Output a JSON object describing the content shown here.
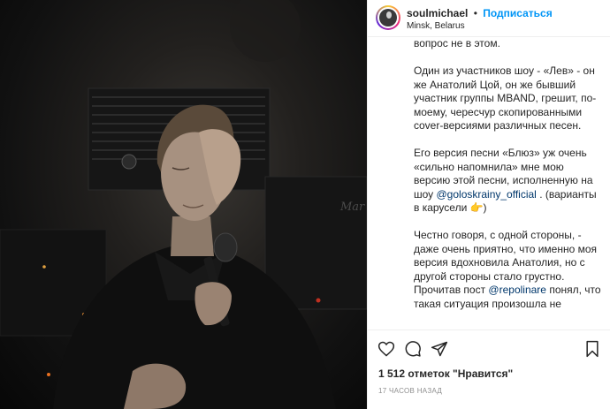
{
  "post": {
    "username": "soulmichael",
    "separator": "•",
    "follow_label": "Подписаться",
    "location": "Minsk, Belarus",
    "likes_text": "1 512 отметок \"Нравится\"",
    "time_text": "17 часов назад"
  },
  "caption": {
    "p0": "вопрос не в этом.",
    "p1": "Один из участников шоу - «Лев» - он же Анатолий Цой, он же бывший участник группы MBAND, грешит, по-моему, чересчур скопированными cover-версиями различных песен.",
    "p2_a": "Его версия песни «Блюз» уж очень «сильно напомнила» мне мою версию этой песни, исполненную на шоу ",
    "p2_mention": "@goloskrainy_official",
    "p2_b": " . (варианты в карусели 👉)",
    "p3_a": "Честно говоря, с одной стороны, - даже очень приятно, что именно моя версия вдохновила Анатолия, но с другой стороны стало грустно. Прочитав пост ",
    "p3_mention": "@repolinare",
    "p3_b": " понял, что такая ситуация произошла не"
  },
  "icons": {
    "like": "heart-icon",
    "comment": "comment-icon",
    "share": "share-icon",
    "save": "bookmark-icon"
  },
  "colors": {
    "link": "#0095f6",
    "mention": "#00376b",
    "meta": "#8e8e8e"
  }
}
